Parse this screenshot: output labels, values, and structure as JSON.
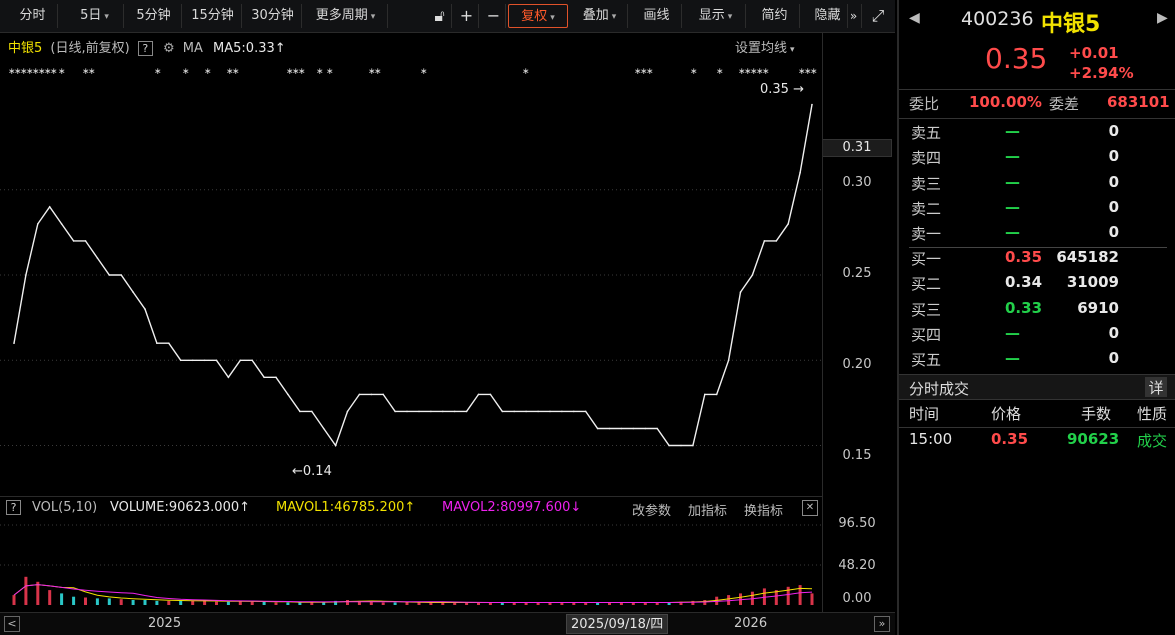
{
  "toolbar": {
    "buttons": [
      "分时",
      "5日",
      "5分钟",
      "15分钟",
      "30分钟",
      "更多周期",
      "复权",
      "叠加",
      "画线",
      "显示",
      "简约",
      "隐藏"
    ],
    "lock_icon": "lock-icon",
    "plus_icon": "plus-icon",
    "minus_icon": "minus-icon",
    "more_icon": "double-chevron-right-icon",
    "fullscreen_icon": "fullscreen-icon"
  },
  "price_chart": {
    "stock_name": "中银5",
    "mode": "(日线,前复权)",
    "help": "?",
    "ma_label": "MA",
    "ma5": "MA5:0.33",
    "ma_arrow": "↑",
    "settings": "设置均线",
    "y_ticks": [
      "0.30",
      "0.25",
      "0.20",
      "0.15"
    ],
    "last_price_box": "0.31",
    "max_label": "0.35",
    "min_label": "0.14",
    "max_arrow": "→",
    "min_arrow": "←"
  },
  "volume_chart": {
    "help": "?",
    "title": "VOL(5,10)",
    "volume": "VOLUME:90623.000",
    "volume_arrow": "↑",
    "mavol1": "MAVOL1:46785.200",
    "mavol1_arrow": "↑",
    "mavol2": "MAVOL2:80997.600",
    "mavol2_arrow": "↓",
    "actions": [
      "改参数",
      "加指标",
      "换指标"
    ],
    "close": "✕",
    "y_ticks": [
      "96.50",
      "48.20",
      "0.00"
    ]
  },
  "date_bar": {
    "left": "2025",
    "cursor": "2025/09/18/四",
    "right": "2026",
    "prev": "<",
    "next": "»"
  },
  "quote": {
    "code": "400236",
    "name": "中银5",
    "price": "0.35",
    "change": "+0.01",
    "change_pct": "+2.94%",
    "weibi_label": "委比",
    "weibi": "100.00%",
    "weicha_label": "委差",
    "weicha": "683101",
    "asks": [
      {
        "label": "卖五",
        "price": "—",
        "vol": "0"
      },
      {
        "label": "卖四",
        "price": "—",
        "vol": "0"
      },
      {
        "label": "卖三",
        "price": "—",
        "vol": "0"
      },
      {
        "label": "卖二",
        "price": "—",
        "vol": "0"
      },
      {
        "label": "卖一",
        "price": "—",
        "vol": "0"
      }
    ],
    "bids": [
      {
        "label": "买一",
        "price": "0.35",
        "vol": "645182"
      },
      {
        "label": "买二",
        "price": "0.34",
        "vol": "31009"
      },
      {
        "label": "买三",
        "price": "0.33",
        "vol": "6910"
      },
      {
        "label": "买四",
        "price": "—",
        "vol": "0"
      },
      {
        "label": "买五",
        "price": "—",
        "vol": "0"
      }
    ],
    "ticks_title": "分时成交",
    "ticks_detail": "详",
    "ticks_headers": [
      "时间",
      "价格",
      "手数",
      "性质"
    ],
    "ticks": [
      {
        "time": "15:00",
        "price": "0.35",
        "vol": "90623",
        "type": "成交"
      }
    ]
  },
  "chart_data": {
    "type": "line",
    "price_ylim": [
      0.138,
      0.355
    ],
    "price_series": [
      0.21,
      0.25,
      0.28,
      0.29,
      0.28,
      0.27,
      0.27,
      0.26,
      0.25,
      0.25,
      0.24,
      0.23,
      0.21,
      0.21,
      0.2,
      0.2,
      0.2,
      0.2,
      0.19,
      0.2,
      0.2,
      0.19,
      0.19,
      0.18,
      0.17,
      0.17,
      0.16,
      0.15,
      0.17,
      0.18,
      0.18,
      0.18,
      0.17,
      0.17,
      0.17,
      0.17,
      0.17,
      0.17,
      0.17,
      0.18,
      0.18,
      0.17,
      0.17,
      0.17,
      0.17,
      0.17,
      0.17,
      0.17,
      0.17,
      0.16,
      0.16,
      0.16,
      0.16,
      0.16,
      0.16,
      0.15,
      0.15,
      0.15,
      0.18,
      0.18,
      0.2,
      0.24,
      0.25,
      0.27,
      0.27,
      0.28,
      0.31,
      0.35
    ],
    "volume_ylim": [
      0,
      96.5
    ],
    "volume_values": [
      12,
      34,
      28,
      18,
      14,
      10,
      9,
      8,
      8,
      7,
      6,
      6,
      5,
      5,
      5,
      5,
      5,
      4,
      4,
      5,
      4,
      4,
      3,
      3,
      3,
      3,
      4,
      5,
      6,
      5,
      4,
      3,
      3,
      3,
      3,
      3,
      3,
      3,
      3,
      3,
      3,
      3,
      3,
      3,
      3,
      3,
      3,
      3,
      3,
      3,
      3,
      3,
      3,
      3,
      3,
      3,
      4,
      5,
      6,
      10,
      12,
      14,
      16,
      20,
      18,
      22,
      24,
      14
    ]
  }
}
